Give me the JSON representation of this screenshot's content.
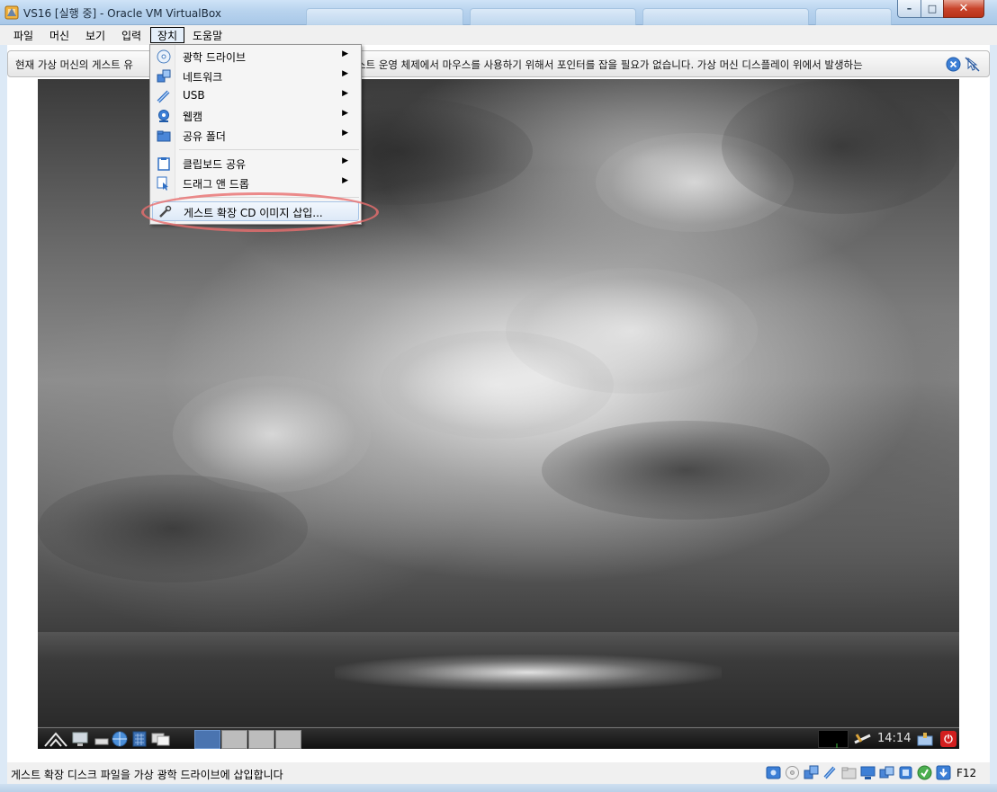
{
  "window": {
    "title": "VS16 [실행 중] - Oracle VM VirtualBox",
    "controls": {
      "minimize": "–",
      "maximize": "□",
      "close": "✕"
    }
  },
  "menubar": {
    "items": [
      "파일",
      "머신",
      "보기",
      "입력",
      "장치",
      "도움말"
    ],
    "active_index": 4
  },
  "notice": {
    "text_left": "현재 가상 머신의 게스트 유",
    "text_right": "스트 운영 체제에서 마우스를 사용하기 위해서 포인터를 잡을 필요가 없습니다. 가상 머신 디스플레이 위에서 발생하는"
  },
  "devices_menu": {
    "items": [
      {
        "label": "광학 드라이브",
        "icon": "optical-drive-icon",
        "submenu": true
      },
      {
        "label": "네트워크",
        "icon": "network-icon",
        "submenu": true
      },
      {
        "label": "USB",
        "icon": "usb-icon",
        "submenu": true
      },
      {
        "label": "웹캠",
        "icon": "webcam-icon",
        "submenu": true
      },
      {
        "label": "공유 폴더",
        "icon": "shared-folder-icon",
        "submenu": true
      },
      {
        "label": "클립보드 공유",
        "icon": "clipboard-icon",
        "submenu": true
      },
      {
        "label": "드래그 앤 드롭",
        "icon": "drag-drop-icon",
        "submenu": true
      },
      {
        "label": "게스트 확장 CD 이미지 삽입...",
        "icon": "guest-additions-icon",
        "submenu": false
      }
    ],
    "submenu_arrow": "▶"
  },
  "guest_taskbar": {
    "clock": "14:14",
    "power_glyph": "⏻"
  },
  "statusbar": {
    "message": "게스트 확장 디스크 파일을 가상 광학 드라이브에 삽입합니다",
    "host_key": "F12"
  },
  "colors": {
    "highlight_ring": "#e86e6e",
    "taskbar_active": "#4a74b0",
    "power_button": "#d21f1f"
  }
}
